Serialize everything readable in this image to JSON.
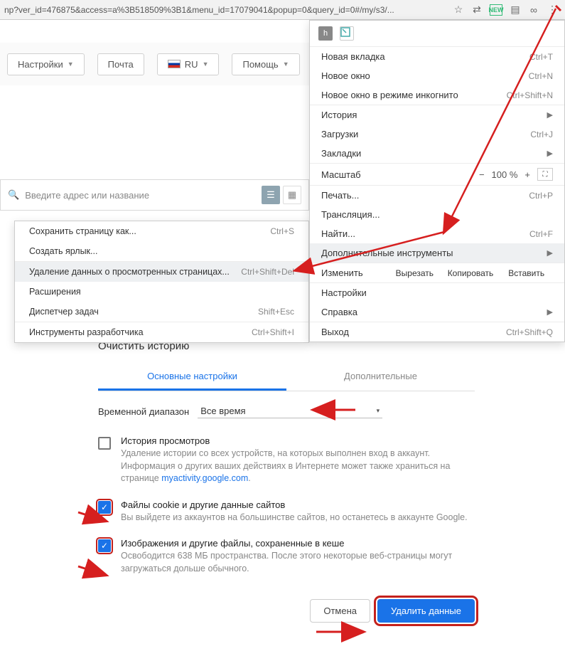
{
  "url_bar": "np?ver_id=476875&access=a%3B518509%3B1&menu_id=17079041&popup=0&query_id=0#/my/s3/...",
  "site_toolbar": {
    "settings": "Настройки",
    "mail": "Почта",
    "lang": "RU",
    "help": "Помощь"
  },
  "search_placeholder": "Введите адрес или название",
  "chrome_menu": {
    "new_tab": {
      "label": "Новая вкладка",
      "shortcut": "Ctrl+T"
    },
    "new_window": {
      "label": "Новое окно",
      "shortcut": "Ctrl+N"
    },
    "incognito": {
      "label": "Новое окно в режиме инкогнито",
      "shortcut": "Ctrl+Shift+N"
    },
    "history": {
      "label": "История"
    },
    "downloads": {
      "label": "Загрузки",
      "shortcut": "Ctrl+J"
    },
    "bookmarks": {
      "label": "Закладки"
    },
    "zoom": {
      "label": "Масштаб",
      "value": "100 %"
    },
    "print": {
      "label": "Печать...",
      "shortcut": "Ctrl+P"
    },
    "cast": {
      "label": "Трансляция..."
    },
    "find": {
      "label": "Найти...",
      "shortcut": "Ctrl+F"
    },
    "more_tools": {
      "label": "Дополнительные инструменты"
    },
    "edit": {
      "label": "Изменить",
      "cut": "Вырезать",
      "copy": "Копировать",
      "paste": "Вставить"
    },
    "settings": {
      "label": "Настройки"
    },
    "help": {
      "label": "Справка"
    },
    "exit": {
      "label": "Выход",
      "shortcut": "Ctrl+Shift+Q"
    }
  },
  "submenu": {
    "save_page": {
      "label": "Сохранить страницу как...",
      "shortcut": "Ctrl+S"
    },
    "create_shortcut": {
      "label": "Создать ярлык..."
    },
    "clear_browsing": {
      "label": "Удаление данных о просмотренных страницах...",
      "shortcut": "Ctrl+Shift+Del"
    },
    "extensions": {
      "label": "Расширения"
    },
    "task_manager": {
      "label": "Диспетчер задач",
      "shortcut": "Shift+Esc"
    },
    "dev_tools": {
      "label": "Инструменты разработчика",
      "shortcut": "Ctrl+Shift+I"
    }
  },
  "dialog": {
    "title": "Очистить историю",
    "tab_basic": "Основные настройки",
    "tab_advanced": "Дополнительные",
    "range_label": "Временной диапазон",
    "range_value": "Все время",
    "opt_history": {
      "title": "История просмотров",
      "desc_a": "Удаление истории со всех устройств, на которых выполнен вход в аккаунт. Информация о других ваших действиях в Интернете может также храниться на странице ",
      "link": "myactivity.google.com",
      "desc_b": "."
    },
    "opt_cookies": {
      "title": "Файлы cookie и другие данные сайтов",
      "desc": "Вы выйдете из аккаунтов на большинстве сайтов, но останетесь в аккаунте Google."
    },
    "opt_cache": {
      "title": "Изображения и другие файлы, сохраненные в кеше",
      "desc": "Освободится 638 МБ пространства. После этого некоторые веб-страницы могут загружаться дольше обычного."
    },
    "cancel": "Отмена",
    "confirm": "Удалить данные"
  }
}
